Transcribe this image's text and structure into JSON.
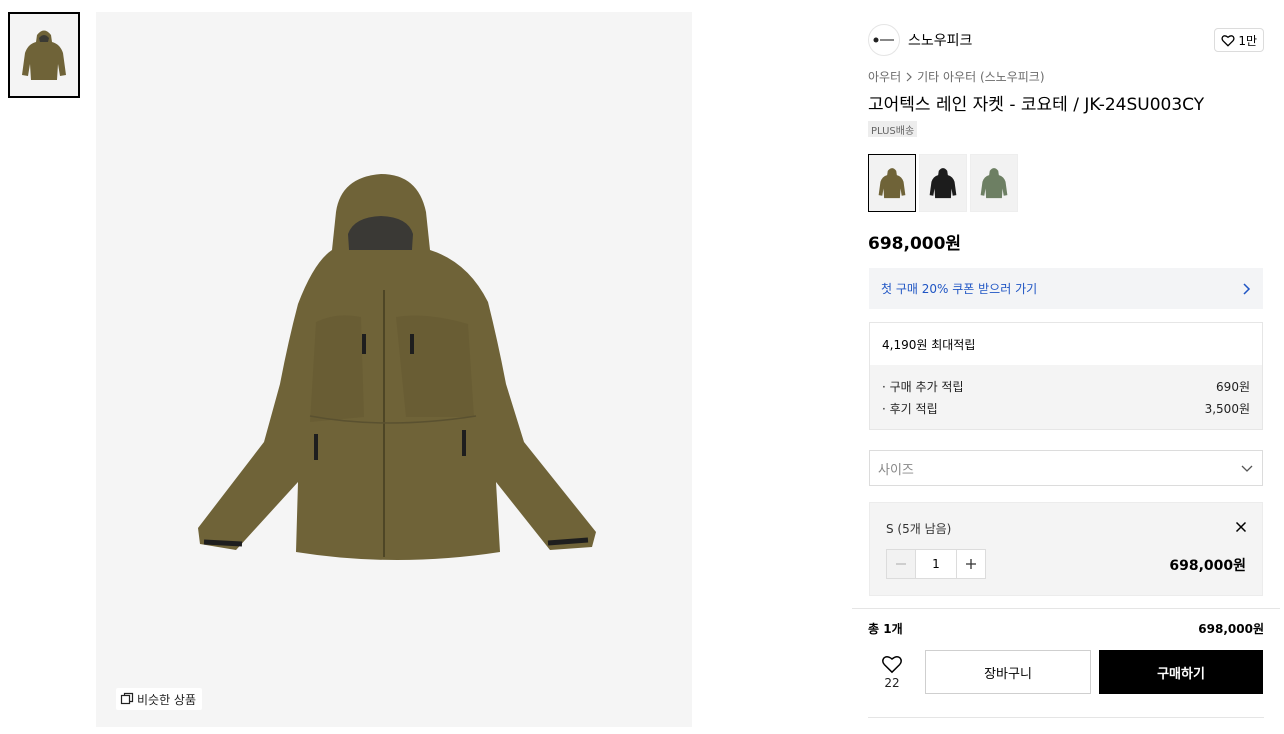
{
  "brand": {
    "name": "스노우피크",
    "likes": "1만"
  },
  "breadcrumb": {
    "level1": "아우터",
    "level2": "기타 아우터 (스노우피크)"
  },
  "product": {
    "title": "고어텍스 레인 자켓 - 코요테 / JK-24SU003CY",
    "shipping_badge": "PLUS배송",
    "price": "698,000원",
    "color_options": [
      "coyote",
      "black",
      "khaki"
    ]
  },
  "gallery": {
    "similar_label": "비슷한 상품"
  },
  "coupon": {
    "text": "첫 구매 20% 쿠폰 받으러 가기"
  },
  "points": {
    "headline": "4,190원 최대적립",
    "lines": [
      {
        "label": "· 구매 추가 적립",
        "value": "690원"
      },
      {
        "label": "· 후기 적립",
        "value": "3,500원"
      }
    ]
  },
  "size": {
    "placeholder": "사이즈"
  },
  "selected_option": {
    "name": "S (5개 남음)",
    "quantity": "1",
    "price": "698,000원"
  },
  "summary": {
    "total_label": "총 1개",
    "total_price": "698,000원"
  },
  "actions": {
    "wish_count": "22",
    "cart_label": "장바구니",
    "buy_label": "구매하기"
  },
  "colors": {
    "coyote": "#6f6338",
    "coupon_text": "#1f55c4",
    "buy_bg": "#000000"
  }
}
